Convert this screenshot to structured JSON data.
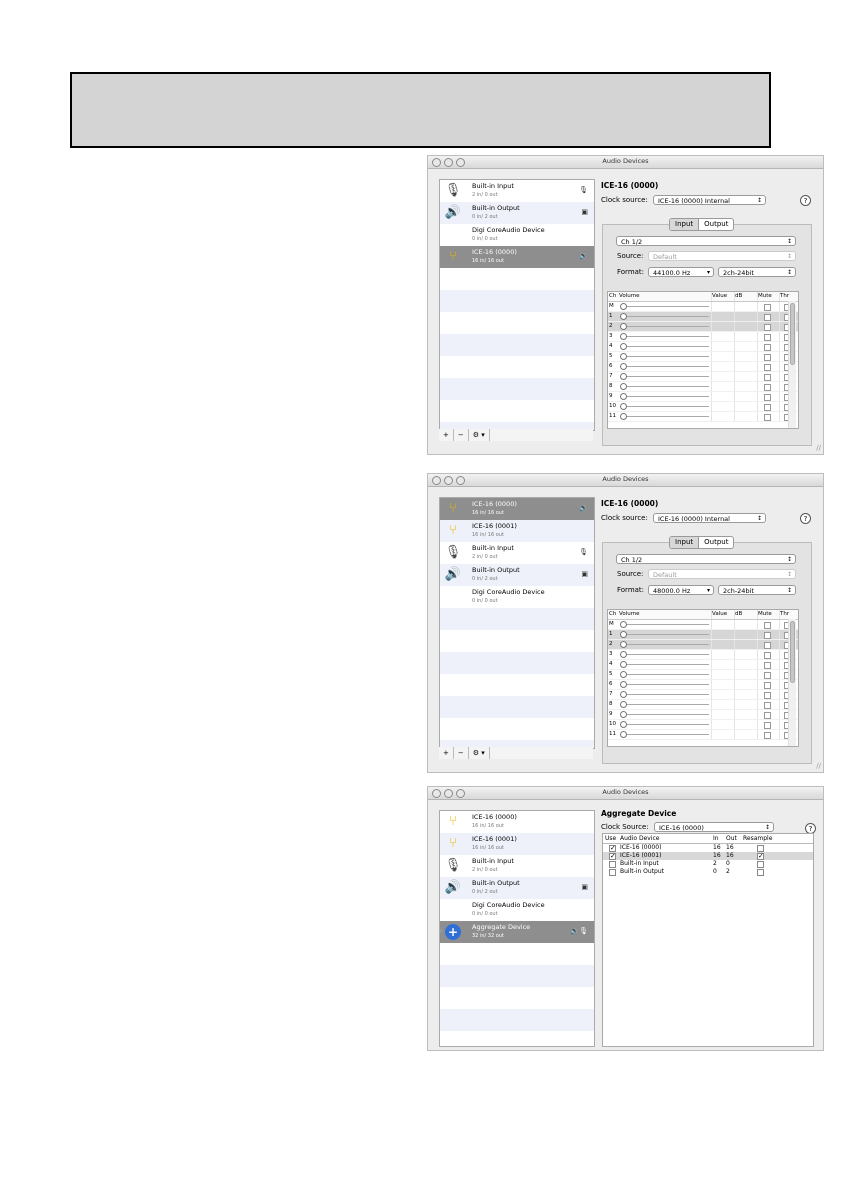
{
  "header_box": {
    "text": ""
  },
  "windows": [
    {
      "title": "Audio Devices",
      "devices": [
        {
          "name": "Built-in Input",
          "sub": "2 in/ 0 out",
          "icon": "microphone-icon",
          "badge": "🎙",
          "selected": false
        },
        {
          "name": "Built-in Output",
          "sub": "0 in/ 2 out",
          "icon": "speaker-icon",
          "badge": "▣",
          "selected": false
        },
        {
          "name": "Digi CoreAudio Device",
          "sub": "0 in/ 0 out",
          "icon": "",
          "badge": "",
          "selected": false
        },
        {
          "name": "ICE-16 (0000)",
          "sub": "16 in/ 16 out",
          "icon": "usb-icon",
          "badge": "🔉",
          "selected": true
        }
      ],
      "pane": {
        "title": "ICE-16 (0000)",
        "clock_label": "Clock source:",
        "clock_value": "ICE-16 (0000) Internal",
        "tabs": [
          "Input",
          "Output"
        ],
        "channel_select": "Ch 1/2",
        "source_label": "Source:",
        "source_value": "Default",
        "format_label": "Format:",
        "format_rate": "44100.0 Hz",
        "format_bits": "2ch-24bit",
        "columns": [
          "Ch",
          "Volume",
          "Value",
          "dB",
          "Mute",
          "Thr"
        ],
        "rows": [
          "M",
          "1",
          "2",
          "3",
          "4",
          "5",
          "6",
          "7",
          "8",
          "9",
          "10",
          "11"
        ]
      },
      "bar": [
        "+",
        "−",
        "⚙ ▾"
      ]
    },
    {
      "title": "Audio Devices",
      "devices": [
        {
          "name": "ICE-16 (0000)",
          "sub": "16 in/ 16 out",
          "icon": "usb-icon",
          "badge": "🔉",
          "selected": true
        },
        {
          "name": "ICE-16 (0001)",
          "sub": "16 in/ 16 out",
          "icon": "usb-icon",
          "badge": "",
          "selected": false
        },
        {
          "name": "Built-in Input",
          "sub": "2 in/ 0 out",
          "icon": "microphone-icon",
          "badge": "🎙",
          "selected": false
        },
        {
          "name": "Built-in Output",
          "sub": "0 in/ 2 out",
          "icon": "speaker-icon",
          "badge": "▣",
          "selected": false
        },
        {
          "name": "Digi CoreAudio Device",
          "sub": "0 in/ 0 out",
          "icon": "",
          "badge": "",
          "selected": false
        }
      ],
      "pane": {
        "title": "ICE-16 (0000)",
        "clock_label": "Clock source:",
        "clock_value": "ICE-16 (0000) Internal",
        "tabs": [
          "Input",
          "Output"
        ],
        "channel_select": "Ch 1/2",
        "source_label": "Source:",
        "source_value": "Default",
        "format_label": "Format:",
        "format_rate": "48000.0 Hz",
        "format_bits": "2ch-24bit",
        "columns": [
          "Ch",
          "Volume",
          "Value",
          "dB",
          "Mute",
          "Thr"
        ],
        "rows": [
          "M",
          "1",
          "2",
          "3",
          "4",
          "5",
          "6",
          "7",
          "8",
          "9",
          "10",
          "11"
        ]
      },
      "bar": [
        "+",
        "−",
        "⚙ ▾"
      ]
    },
    {
      "title": "Audio Devices",
      "devices": [
        {
          "name": "ICE-16 (0000)",
          "sub": "16 in/ 16 out",
          "icon": "usb-icon",
          "badge": "",
          "selected": false
        },
        {
          "name": "ICE-16 (0001)",
          "sub": "16 in/ 16 out",
          "icon": "usb-icon",
          "badge": "",
          "selected": false
        },
        {
          "name": "Built-in Input",
          "sub": "2 in/ 0 out",
          "icon": "microphone-icon",
          "badge": "",
          "selected": false
        },
        {
          "name": "Built-in Output",
          "sub": "0 in/ 2 out",
          "icon": "speaker-icon",
          "badge": "▣",
          "selected": false
        },
        {
          "name": "Digi CoreAudio Device",
          "sub": "0 in/ 0 out",
          "icon": "",
          "badge": "",
          "selected": false
        },
        {
          "name": "Aggregate Device",
          "sub": "32 in/ 32 out",
          "icon": "aggregate-icon",
          "badge": "🔉🎙",
          "selected": true
        }
      ],
      "aggregate": {
        "title": "Aggregate Device",
        "clock_label": "Clock Source:",
        "clock_value": "ICE-16 (0000)",
        "columns": [
          "Use",
          "Audio Device",
          "In",
          "Out",
          "Resample"
        ],
        "rows": [
          {
            "use": true,
            "device": "ICE-16 (0000)",
            "in": "16",
            "out": "16",
            "resample": false,
            "highlight": false
          },
          {
            "use": true,
            "device": "ICE-16 (0001)",
            "in": "16",
            "out": "16",
            "resample": true,
            "highlight": true
          },
          {
            "use": false,
            "device": "Built-in Input",
            "in": "2",
            "out": "0",
            "resample": false,
            "highlight": false
          },
          {
            "use": false,
            "device": "Built-in Output",
            "in": "0",
            "out": "2",
            "resample": false,
            "highlight": false
          }
        ]
      }
    }
  ]
}
